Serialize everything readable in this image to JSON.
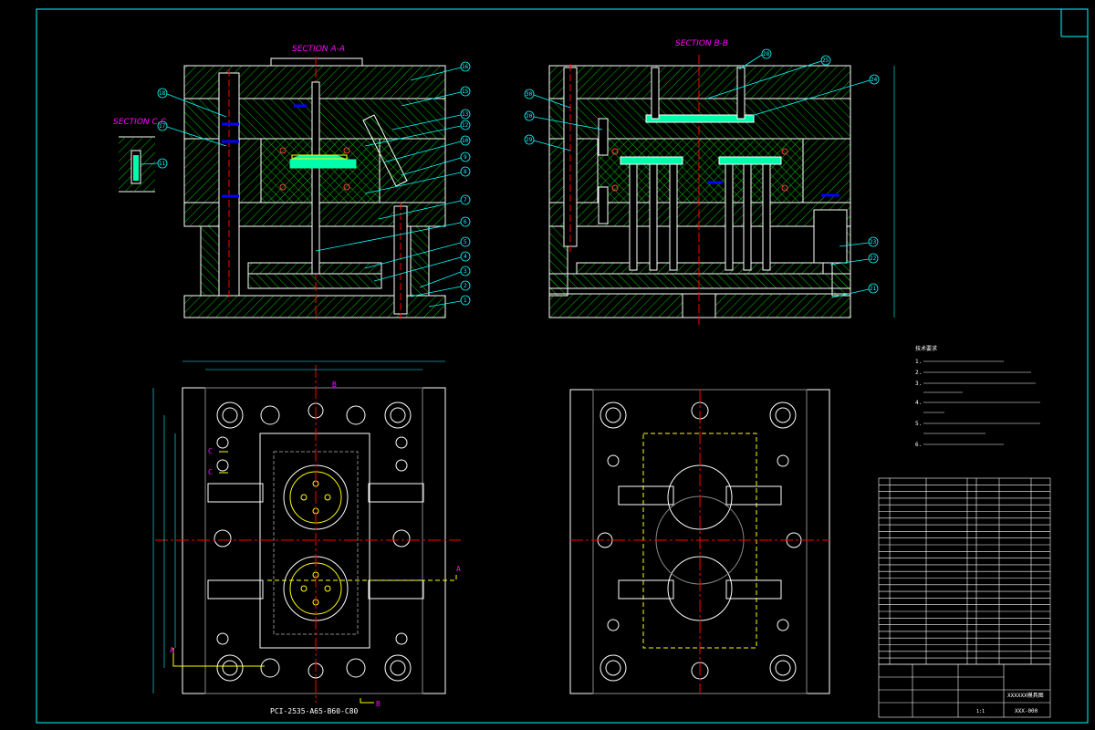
{
  "drawing": {
    "section_aa": "SECTION A-A",
    "section_bb": "SECTION B-B",
    "section_cc": "SECTION C-C",
    "mold_base_code": "PCI-2535-A65-B60-C80",
    "cut_letters": {
      "a": "A",
      "b": "B",
      "c": "C"
    }
  },
  "balloons_aa": [
    "16",
    "15",
    "13",
    "12",
    "10",
    "9",
    "8",
    "7",
    "6",
    "5",
    "4",
    "3",
    "2",
    "1",
    "18",
    "17"
  ],
  "balloons_cc": [
    "11"
  ],
  "balloons_bb": [
    "28",
    "25",
    "24",
    "30",
    "20",
    "29",
    "23",
    "22",
    "21"
  ],
  "notes": {
    "title": "技术要求",
    "lines": [
      "1.",
      "2.",
      "3.",
      "4.",
      "5.",
      "6."
    ]
  },
  "title_block": {
    "drawing_name": "XXXXXX模具图",
    "drawing_number": "XXX-000",
    "scale": "1:1"
  },
  "colors": {
    "background": "#000000",
    "frame": "#00ffff",
    "hatch": "#00c000",
    "outline": "#ffffff",
    "centerline": "#ff0000",
    "section_label": "#ff00ff",
    "leader": "#00ffff",
    "accent": "#ffff00",
    "highlight": "#00ffaa"
  }
}
